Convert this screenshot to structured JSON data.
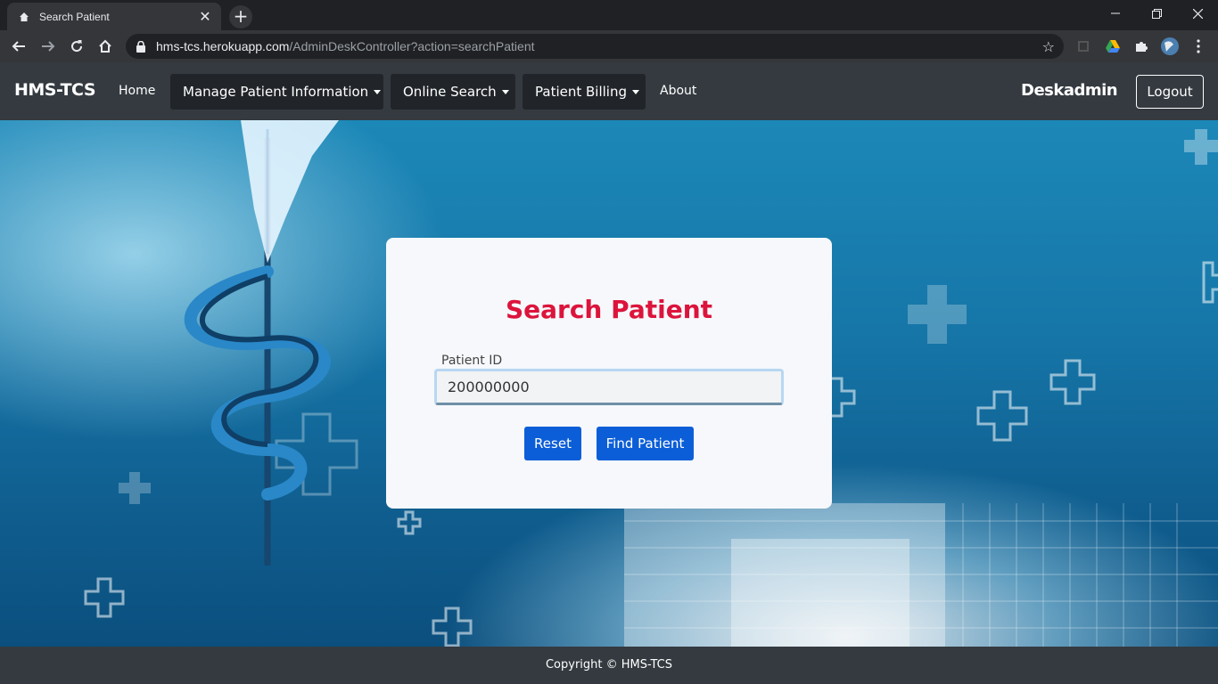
{
  "browser": {
    "tab_title": "Search Patient",
    "url_host": "hms-tcs.herokuapp.com",
    "url_path": "/AdminDeskController?action=searchPatient"
  },
  "navbar": {
    "brand": "HMS-TCS",
    "home": "Home",
    "manage_patient": "Manage Patient Information",
    "online_search": "Online Search",
    "patient_billing": "Patient Billing",
    "about": "About",
    "user": "Deskadmin",
    "logout": "Logout"
  },
  "form": {
    "title": "Search Patient",
    "patient_id_label": "Patient ID",
    "patient_id_value": "200000000",
    "reset_label": "Reset",
    "find_label": "Find Patient"
  },
  "footer": {
    "copyright": "Copyright © HMS-TCS"
  },
  "colors": {
    "title_accent": "#dc143c",
    "primary_button": "#0b5ed7",
    "navbar_bg": "#343a40"
  }
}
